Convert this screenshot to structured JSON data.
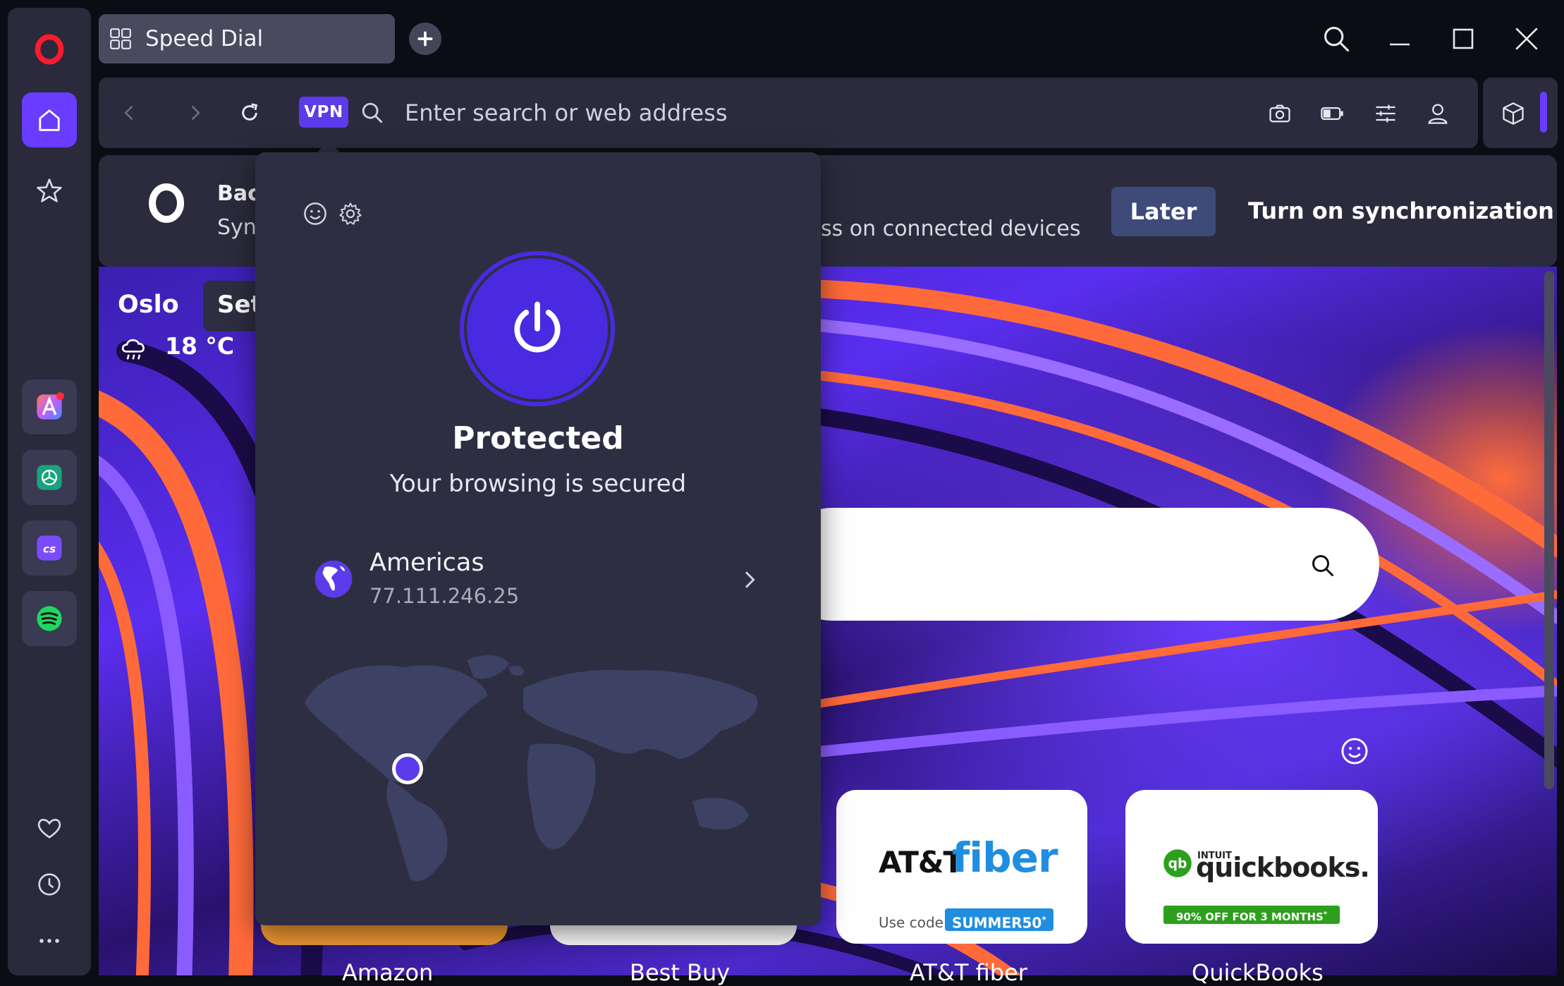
{
  "tab": {
    "title": "Speed Dial",
    "icon": "speed-dial-grid-icon"
  },
  "address_bar": {
    "vpn_badge": "VPN",
    "placeholder": "Enter search or web address"
  },
  "sync_banner": {
    "title": "Bacl",
    "subtitle": "Sync",
    "subtitle_tail": "ss on connected devices",
    "later_label": "Later",
    "turn_on_label": "Turn on synchronization"
  },
  "weather": {
    "city": "Oslo",
    "temperature": "18 °C",
    "set_label": "Set"
  },
  "vpn_popup": {
    "status_title": "Protected",
    "status_subtitle": "Your browsing is secured",
    "region": "Americas",
    "ip": "77.111.246.25",
    "accent": "#5b3bea"
  },
  "speed_dial": [
    {
      "label": "Amazon"
    },
    {
      "label": "Best Buy"
    },
    {
      "label": "AT&T fiber",
      "logo_text_a": "AT&T",
      "logo_text_b": "fiber",
      "promo_prefix": "Use code",
      "promo_code": "SUMMER50",
      "promo_mark": "*"
    },
    {
      "label": "QuickBooks",
      "logo_brand": "INTUIT",
      "logo_text": "quickbooks",
      "logo_dot": ".",
      "promo": "90% OFF FOR 3 MONTHS",
      "promo_mark": "*"
    }
  ],
  "colors": {
    "sidebar": "#2a2a3c",
    "toolbar": "#2b2b3d",
    "popup": "#2e2e42",
    "opera_red": "#ff1b2d"
  }
}
